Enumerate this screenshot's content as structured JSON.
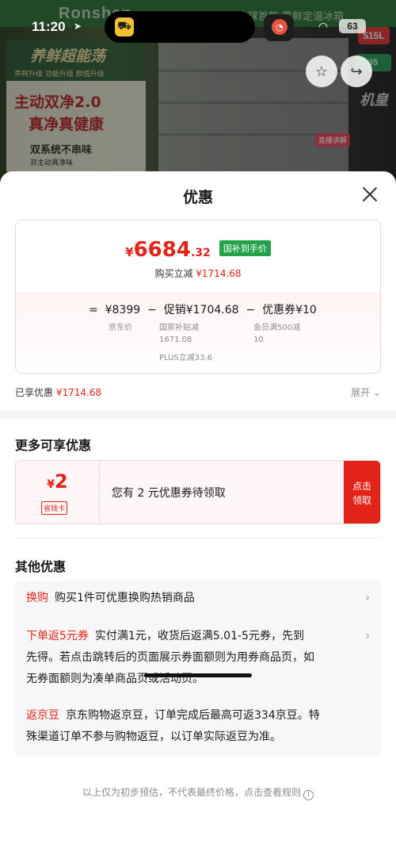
{
  "status_bar": {
    "time": "11:20",
    "battery": "63"
  },
  "background": {
    "brand": "Ronshen",
    "banner": "全球首款 蓄鲜定温冰箱",
    "promo_title": "养鲜超能荡",
    "promo_tags": "养鲜升级  功能升级  颜值升级",
    "promo_line1": "主动双净2.0",
    "promo_line2": "真净真健康",
    "promo_line3": "双系统不串味",
    "promo_line4": "双主动真净味",
    "badge_capacity": "515L",
    "badge_extra": "35",
    "label_jihuang": "机皇",
    "label_live": "直播讲解"
  },
  "sheet": {
    "title": "优惠",
    "price": {
      "currency": "¥",
      "integer": "6684",
      "decimal": ".32",
      "gov_tag": "国补到手价"
    },
    "instant_discount_label": "购买立减",
    "instant_discount_value": "¥1714.68",
    "formula": {
      "eq": "=",
      "jd_price": "¥8399",
      "minus1": "−",
      "promo": "促销¥1704.68",
      "minus2": "−",
      "coupon": "优惠券¥10",
      "jd_price_label": "京东价",
      "promo_detail1": "国家补贴减",
      "promo_detail1_val": "1671.08",
      "promo_detail2": "PLUS立减33.6",
      "coupon_detail": "会员满500减",
      "coupon_detail_val": "10"
    },
    "enjoyed_label": "已享优惠",
    "enjoyed_value": "¥1714.68",
    "expand_label": "展开",
    "more_title": "更多可享优惠",
    "coupon": {
      "currency": "¥",
      "amount": "2",
      "tag": "省钱卡",
      "text": "您有 2 元优惠券待领取",
      "btn_line1": "点击",
      "btn_line2": "领取"
    },
    "others_title": "其他优惠",
    "others": [
      {
        "tag": "换购",
        "lines": [
          "购买1件可优惠换购热销商品"
        ]
      },
      {
        "tag": "下单返5元券",
        "lines": [
          "实付满1元，收货后返满5.01-5元券，先到",
          "先得。若点击跳转后的页面展示券面额则为用券商品页，如",
          "无券面额则为凑单商品页或活动页。"
        ]
      },
      {
        "tag": "返京豆",
        "lines": [
          "京东购物返京豆，订单完成后最高可返334京豆。特",
          "殊渠道订单不参与购物返豆，以订单实际返豆为准。"
        ]
      }
    ],
    "footer_note": "以上仅为初步预估，不代表最终价格，点击查看规则"
  },
  "colors": {
    "accent_red": "#e2231a",
    "gov_green": "#22a34a"
  }
}
